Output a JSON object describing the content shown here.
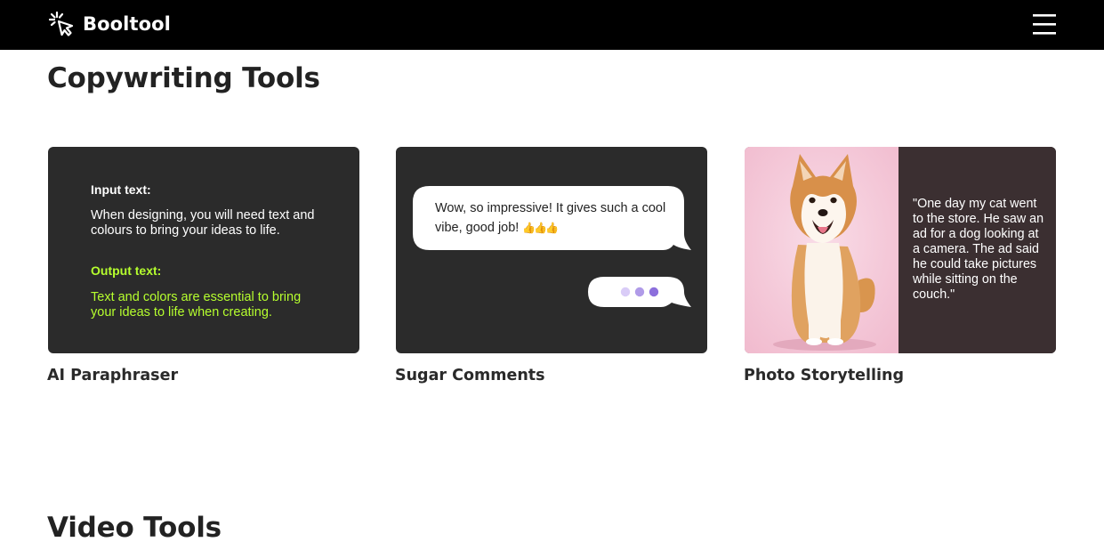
{
  "header": {
    "brand_name": "Booltool",
    "brand_icon": "cursor-click-icon",
    "menu_icon": "hamburger-menu-icon"
  },
  "sections": [
    {
      "title": "Copywriting Tools",
      "cards": [
        {
          "title": "AI Paraphraser",
          "thumbnail": {
            "input_label": "Input text:",
            "input_text": "When designing, you will need text and colours to bring your ideas to life.",
            "output_label": "Output text:",
            "output_text": "Text and colors are essential to bring your ideas to life when creating."
          }
        },
        {
          "title": "Sugar Comments",
          "thumbnail": {
            "comment_text": "Wow, so impressive! It gives such a cool vibe, good job!",
            "comment_emoji": "👍👍👍",
            "typing_icon": "typing-dots-icon"
          }
        },
        {
          "title": "Photo Storytelling",
          "thumbnail": {
            "image": "shiba-inu-dog-photo",
            "story_text": "\"One day my cat went to the store. He saw an ad for a dog looking at a camera. The ad said he could take pictures while sitting on the couch.\""
          }
        }
      ]
    },
    {
      "title": "Video Tools",
      "cards": []
    }
  ],
  "colors": {
    "header_bg": "#000000",
    "card_bg": "#2b2b2b",
    "output_text": "#b6ff2e",
    "story_bg": "#3b2f31",
    "photo_bg": "#f5c8d8",
    "typing_dots": [
      "#d9ccf7",
      "#b09be8",
      "#8c6fdc"
    ]
  }
}
